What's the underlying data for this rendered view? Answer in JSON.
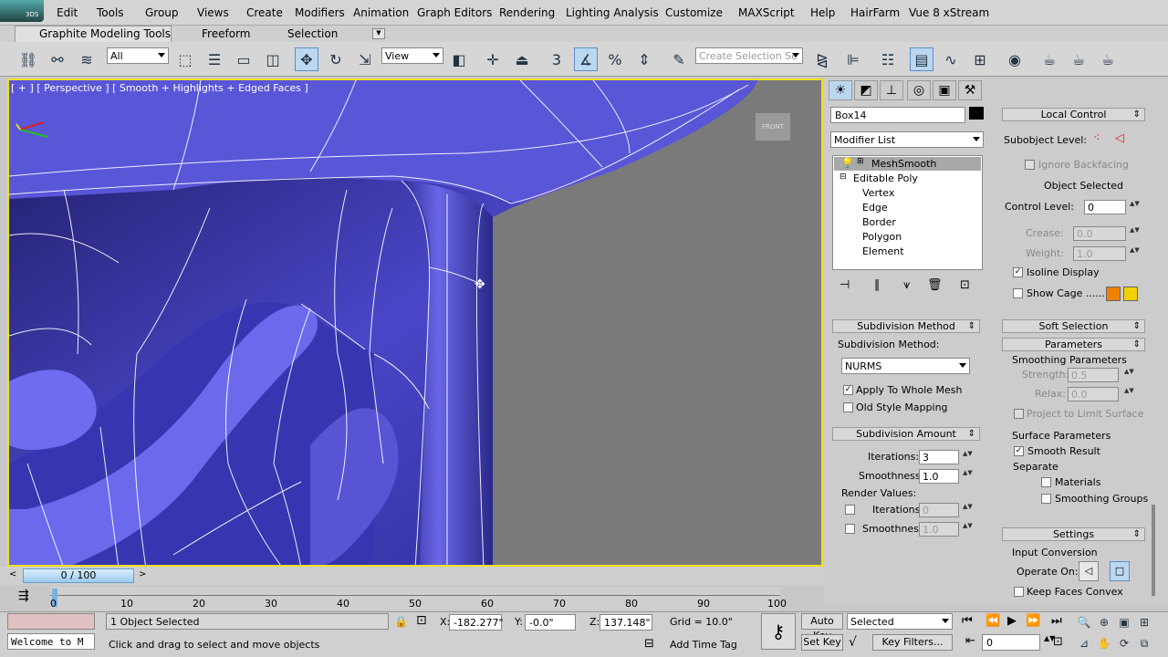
{
  "menu": [
    "Edit",
    "Tools",
    "Group",
    "Views",
    "Create",
    "Modifiers",
    "Animation",
    "Graph Editors",
    "Rendering",
    "Lighting Analysis",
    "Customize",
    "MAXScript",
    "Help",
    "HairFarm",
    "Vue 8 xStream"
  ],
  "logo_text": "3DS",
  "ribbon_tabs": [
    "Graphite Modeling Tools",
    "Freeform",
    "Selection"
  ],
  "toolbar": {
    "filter_value": "All",
    "ref_coord_value": "View",
    "snap_label": "3",
    "selection_set_placeholder": "Create Selection Se"
  },
  "viewport": {
    "label": "[ + ] [ Perspective ] [ Smooth + Highlights + Edged Faces ]",
    "viewcube_text": "FRONT"
  },
  "cmd": {
    "object_name": "Box14",
    "modifier_list": "Modifier List",
    "stack": [
      "MeshSmooth",
      "Editable Poly",
      "Vertex",
      "Edge",
      "Border",
      "Polygon",
      "Element"
    ],
    "subdivision_method": {
      "title": "Subdivision Method",
      "label": "Subdivision Method:",
      "value": "NURMS",
      "apply_whole_mesh": "Apply To Whole Mesh",
      "old_style_mapping": "Old Style Mapping"
    },
    "subdivision_amount": {
      "title": "Subdivision Amount",
      "iterations_label": "Iterations:",
      "iterations": "3",
      "smoothness_label": "Smoothness:",
      "smoothness": "1.0",
      "render_values": "Render Values:",
      "r_iterations_label": "Iterations:",
      "r_iterations": "0",
      "r_smoothness_label": "Smoothness:",
      "r_smoothness": "1.0"
    },
    "local_control": {
      "title": "Local Control",
      "subobject_level": "Subobject Level:",
      "ignore_backfacing": "Ignore Backfacing",
      "object_selected": "Object Selected",
      "control_level_label": "Control Level:",
      "control_level": "0",
      "crease_label": "Crease:",
      "crease": "0.0",
      "weight_label": "Weight:",
      "weight": "1.0",
      "isoline_display": "Isoline Display",
      "show_cage": "Show Cage ......"
    },
    "soft_selection": {
      "title": "Soft Selection"
    },
    "parameters": {
      "title": "Parameters",
      "smoothing_parameters": "Smoothing Parameters",
      "strength_label": "Strength:",
      "strength": "0.5",
      "relax_label": "Relax:",
      "relax": "0.0",
      "project_limit": "Project to Limit Surface",
      "surface_parameters": "Surface Parameters",
      "smooth_result": "Smooth Result",
      "separate": "Separate",
      "materials": "Materials",
      "smoothing_groups": "Smoothing Groups"
    },
    "settings": {
      "title": "Settings",
      "input_conversion": "Input Conversion",
      "operate_on": "Operate On:",
      "keep_faces_convex": "Keep Faces Convex"
    }
  },
  "timeline": {
    "slider": "0 / 100",
    "ticks": [
      "0",
      "10",
      "20",
      "30",
      "40",
      "50",
      "60",
      "70",
      "80",
      "90",
      "100"
    ]
  },
  "status": {
    "maxscript_listener": "Welcome to M",
    "selection": "1 Object Selected",
    "prompt": "Click and drag to select and move objects",
    "x_label": "X:",
    "x": "-182.277\"",
    "y_label": "Y:",
    "y": "-0.0\"",
    "z_label": "Z:",
    "z": "137.148\"",
    "grid": "Grid = 10.0\"",
    "add_time_tag": "Add Time Tag",
    "auto_key": "Auto Key",
    "set_key": "Set Key",
    "selected": "Selected",
    "key_filters": "Key Filters...",
    "frame": "0"
  },
  "colors": {
    "mesh": "#4a46c8",
    "viewport_bg": "#7a7a7a",
    "border_active": "#f0e020",
    "cage1": "#f08000",
    "cage2": "#f0d000"
  }
}
